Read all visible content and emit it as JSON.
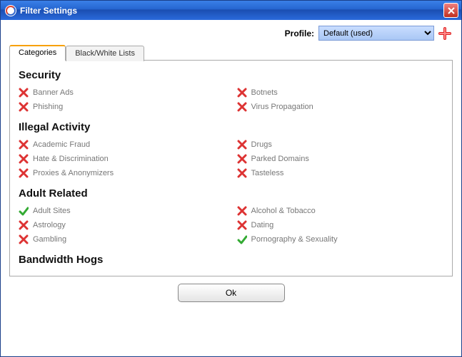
{
  "window": {
    "title": "Filter Settings"
  },
  "profile": {
    "label": "Profile:",
    "selected": "Default (used)"
  },
  "tabs": [
    {
      "label": "Categories"
    },
    {
      "label": "Black/White Lists"
    }
  ],
  "active_tab": 0,
  "groups": [
    {
      "name": "Security",
      "items_left": [
        {
          "label": "Banner Ads",
          "state": "blocked"
        },
        {
          "label": "Phishing",
          "state": "blocked"
        }
      ],
      "items_right": [
        {
          "label": "Botnets",
          "state": "blocked"
        },
        {
          "label": "Virus Propagation",
          "state": "blocked"
        }
      ]
    },
    {
      "name": "Illegal Activity",
      "items_left": [
        {
          "label": "Academic Fraud",
          "state": "blocked"
        },
        {
          "label": "Hate & Discrimination",
          "state": "blocked"
        },
        {
          "label": "Proxies & Anonymizers",
          "state": "blocked"
        }
      ],
      "items_right": [
        {
          "label": "Drugs",
          "state": "blocked"
        },
        {
          "label": "Parked Domains",
          "state": "blocked"
        },
        {
          "label": "Tasteless",
          "state": "blocked"
        }
      ]
    },
    {
      "name": "Adult Related",
      "items_left": [
        {
          "label": "Adult Sites",
          "state": "allowed"
        },
        {
          "label": "Astrology",
          "state": "blocked"
        },
        {
          "label": "Gambling",
          "state": "blocked"
        }
      ],
      "items_right": [
        {
          "label": "Alcohol & Tobacco",
          "state": "blocked"
        },
        {
          "label": "Dating",
          "state": "blocked"
        },
        {
          "label": "Pornography & Sexuality",
          "state": "allowed"
        }
      ]
    },
    {
      "name": "Bandwidth Hogs",
      "items_left": [],
      "items_right": []
    }
  ],
  "footer": {
    "ok_label": "Ok"
  },
  "icons": {
    "cross": "cross-icon",
    "check": "check-icon",
    "add": "plus-icon",
    "close": "close-icon",
    "app": "app-icon"
  }
}
